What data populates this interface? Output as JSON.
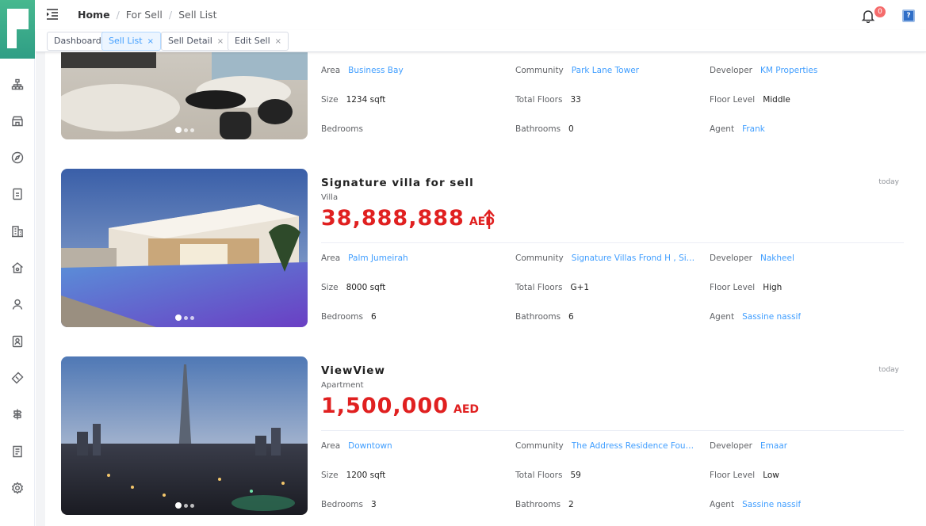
{
  "breadcrumb": {
    "home": "Home",
    "section": "For Sell",
    "current": "Sell List",
    "sep": "/"
  },
  "notifications": {
    "count": "0"
  },
  "help": {
    "label": "?"
  },
  "tags": [
    {
      "label": "Dashboard",
      "closable": false
    },
    {
      "label": "Sell List",
      "closable": true,
      "active": true
    },
    {
      "label": "Sell Detail",
      "closable": true
    },
    {
      "label": "Edit Sell",
      "closable": true
    }
  ],
  "tag_close": "×",
  "sidebar": {
    "icons": [
      "structure-icon",
      "store-icon",
      "compass-icon",
      "document-icon",
      "building-icon",
      "house-icon",
      "user-icon",
      "contact-icon",
      "ticket-icon",
      "signpost-icon",
      "list-icon",
      "settings-icon"
    ]
  },
  "listings": [
    {
      "title": "",
      "type": "",
      "price": "",
      "currency": "",
      "date": "",
      "area_label": "Area",
      "area": "Business Bay",
      "community_label": "Community",
      "community": "Park Lane Tower",
      "developer_label": "Developer",
      "developer": "KM Properties",
      "size_label": "Size",
      "size": "1234 sqft",
      "floors_label": "Total Floors",
      "floors": "33",
      "floor_level_label": "Floor Level",
      "floor_level": "Middle",
      "bedrooms_label": "Bedrooms",
      "bedrooms": "",
      "bathrooms_label": "Bathrooms",
      "bathrooms": "0",
      "agent_label": "Agent",
      "agent": "Frank"
    },
    {
      "title": "Signature villa for sell",
      "type": "Villa",
      "price": "38,888,888",
      "currency": "AED",
      "date": "today",
      "trend": "up",
      "area_label": "Area",
      "area": "Palm Jumeirah",
      "community_label": "Community",
      "community": "Signature Villas Frond H , Signature Villas",
      "developer_label": "Developer",
      "developer": "Nakheel",
      "size_label": "Size",
      "size": "8000 sqft",
      "floors_label": "Total Floors",
      "floors": "G+1",
      "floor_level_label": "Floor Level",
      "floor_level": "High",
      "bedrooms_label": "Bedrooms",
      "bedrooms": "6",
      "bathrooms_label": "Bathrooms",
      "bathrooms": "6",
      "agent_label": "Agent",
      "agent": "Sassine nassif"
    },
    {
      "title": "ViewView",
      "type": "Apartment",
      "price": "1,500,000",
      "currency": "AED",
      "date": "today",
      "area_label": "Area",
      "area": "Downtown",
      "community_label": "Community",
      "community": "The Address Residence Fountain Views",
      "developer_label": "Developer",
      "developer": "Emaar",
      "size_label": "Size",
      "size": "1200 sqft",
      "floors_label": "Total Floors",
      "floors": "59",
      "floor_level_label": "Floor Level",
      "floor_level": "Low",
      "bedrooms_label": "Bedrooms",
      "bedrooms": "3",
      "bathrooms_label": "Bathrooms",
      "bathrooms": "2",
      "agent_label": "Agent",
      "agent": "Sassine nassif"
    }
  ],
  "colors": {
    "accent": "#409eff",
    "price": "#e02020",
    "brand": "#3aab8a",
    "badge": "#f56c6c"
  }
}
